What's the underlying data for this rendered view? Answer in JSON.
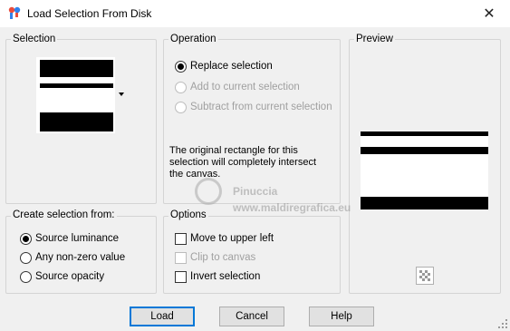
{
  "window": {
    "title": "Load Selection From Disk",
    "close_glyph": "✕"
  },
  "selection": {
    "label": "Selection"
  },
  "operation": {
    "label": "Operation",
    "options": [
      {
        "label": "Replace selection",
        "checked": true,
        "enabled": true
      },
      {
        "label": "Add to current selection",
        "checked": false,
        "enabled": false
      },
      {
        "label": "Subtract from current selection",
        "checked": false,
        "enabled": false
      }
    ],
    "note": "The original rectangle for this selection will completely intersect the canvas."
  },
  "preview": {
    "label": "Preview",
    "checker_icon": "checkerboard-icon"
  },
  "create_from": {
    "label": "Create selection from:",
    "options": [
      {
        "label": "Source luminance",
        "checked": true
      },
      {
        "label": "Any non-zero value",
        "checked": false
      },
      {
        "label": "Source opacity",
        "checked": false
      }
    ]
  },
  "options": {
    "label": "Options",
    "items": [
      {
        "label": "Move to upper left",
        "checked": false,
        "enabled": true
      },
      {
        "label": "Clip to canvas",
        "checked": false,
        "enabled": false
      },
      {
        "label": "Invert selection",
        "checked": false,
        "enabled": true
      }
    ]
  },
  "buttons": {
    "load": "Load",
    "cancel": "Cancel",
    "help": "Help"
  },
  "watermark": {
    "line1": "Pinuccia",
    "line2": "www.maldiregrafica.eu"
  }
}
